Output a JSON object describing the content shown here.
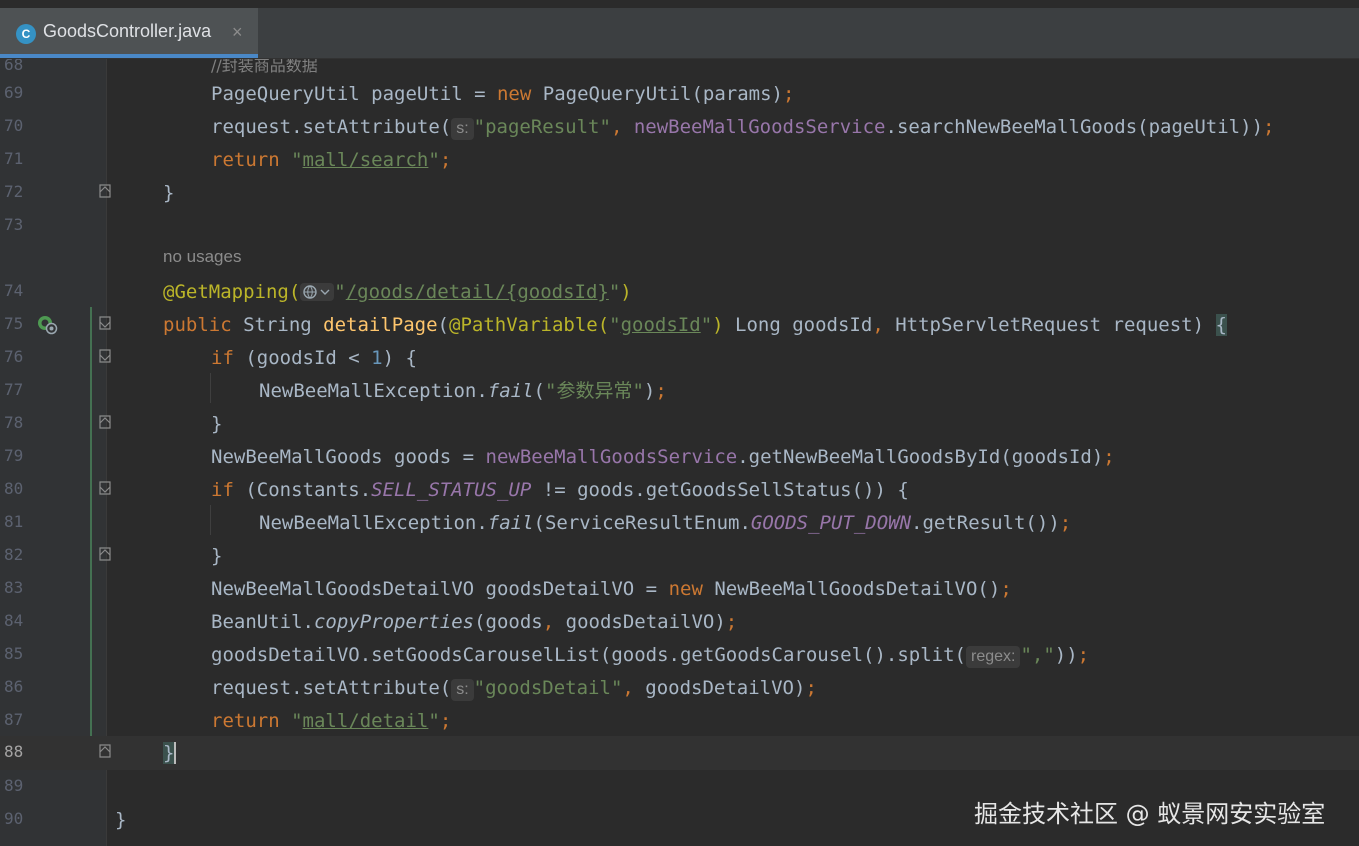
{
  "tab": {
    "title": "GoodsController.java",
    "icon_letter": "C",
    "close": "×"
  },
  "editor": {
    "usages_label": "no usages",
    "hints": {
      "s": "s:",
      "regex": "regex:"
    },
    "lines": [
      {
        "n": "68",
        "text": "//封装商品数据"
      },
      {
        "n": "69",
        "tokens": [
          "PageQueryUtil pageUtil = ",
          "new",
          " PageQueryUtil(params)",
          ";"
        ]
      },
      {
        "n": "70",
        "tokens": [
          "request.setAttribute(",
          "\"pageResult\"",
          ", ",
          "newBeeMallGoodsService",
          ".searchNewBeeMallGoods(pageUtil))",
          ";"
        ]
      },
      {
        "n": "71",
        "tokens": [
          "return",
          " ",
          "\"",
          "mall/search",
          "\"",
          ";"
        ]
      },
      {
        "n": "72",
        "tokens": [
          "}"
        ]
      },
      {
        "n": "73"
      },
      {
        "n": "74",
        "tokens": [
          "@GetMapping(",
          "\"",
          "/goods/detail/{goodsId}",
          "\"",
          ")"
        ]
      },
      {
        "n": "75",
        "tokens": [
          "public",
          " String ",
          "detailPage",
          "(",
          "@PathVariable(",
          "\"",
          "goodsId",
          "\"",
          ")",
          " Long goodsId",
          ", ",
          "HttpServletRequest request) ",
          "{"
        ]
      },
      {
        "n": "76",
        "tokens": [
          "if",
          " (goodsId < ",
          "1",
          ") {"
        ]
      },
      {
        "n": "77",
        "tokens": [
          "NewBeeMallException.",
          "fail",
          "(",
          "\"参数异常\"",
          ")",
          ";"
        ]
      },
      {
        "n": "78",
        "tokens": [
          "}"
        ]
      },
      {
        "n": "79",
        "tokens": [
          "NewBeeMallGoods goods = ",
          "newBeeMallGoodsService",
          ".getNewBeeMallGoodsById(goodsId)",
          ";"
        ]
      },
      {
        "n": "80",
        "tokens": [
          "if",
          " (Constants.",
          "SELL_STATUS_UP",
          " != goods.getGoodsSellStatus()) {"
        ]
      },
      {
        "n": "81",
        "tokens": [
          "NewBeeMallException.",
          "fail",
          "(ServiceResultEnum.",
          "GOODS_PUT_DOWN",
          ".getResult())",
          ";"
        ]
      },
      {
        "n": "82",
        "tokens": [
          "}"
        ]
      },
      {
        "n": "83",
        "tokens": [
          "NewBeeMallGoodsDetailVO goodsDetailVO = ",
          "new",
          " NewBeeMallGoodsDetailVO()",
          ";"
        ]
      },
      {
        "n": "84",
        "tokens": [
          "BeanUtil.",
          "copyProperties",
          "(goods",
          ", ",
          "goodsDetailVO)",
          ";"
        ]
      },
      {
        "n": "85",
        "tokens": [
          "goodsDetailVO.setGoodsCarouselList(goods.getGoodsCarousel().split(",
          "\",\"",
          "))",
          ";"
        ]
      },
      {
        "n": "86",
        "tokens": [
          "request.setAttribute(",
          "\"goodsDetail\"",
          ", ",
          "goodsDetailVO)",
          ";"
        ]
      },
      {
        "n": "87",
        "tokens": [
          "return",
          " ",
          "\"",
          "mall/detail",
          "\"",
          ";"
        ]
      },
      {
        "n": "88",
        "tokens": [
          "}"
        ]
      },
      {
        "n": "89"
      },
      {
        "n": "90",
        "tokens": [
          "}"
        ]
      }
    ]
  },
  "watermark": "掘金技术社区 @ 蚁景网安实验室",
  "colors": {
    "background": "#2b2b2b",
    "keyword": "#cc7832",
    "string": "#6a8759",
    "annotation": "#bbb529",
    "field": "#9876aa",
    "method": "#ffc66d",
    "number": "#6897bb",
    "text": "#a9b7c6"
  }
}
